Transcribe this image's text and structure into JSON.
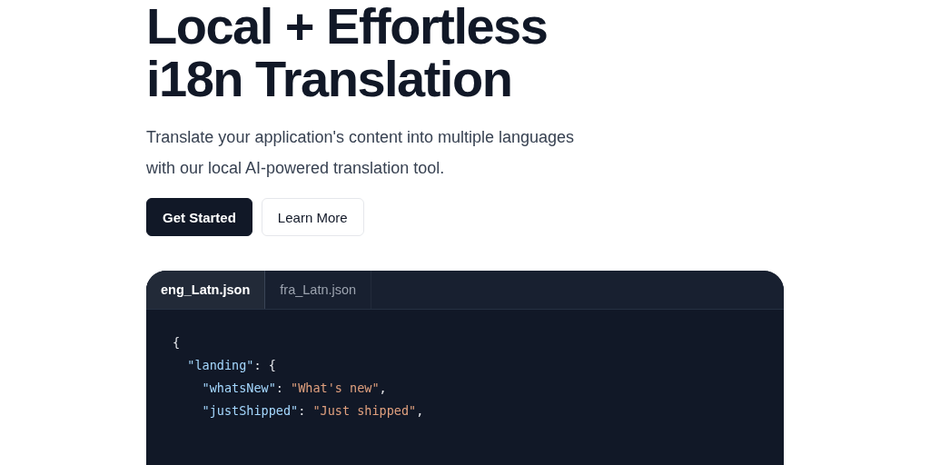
{
  "hero": {
    "title_lines": [
      "Local + Effortless",
      "i18n Translation"
    ],
    "description": "Translate your application's content into multiple languages with our local AI-powered translation tool.",
    "buttons": [
      {
        "label": "Get Started",
        "kind": "primary"
      },
      {
        "label": "Learn More",
        "kind": "secondary"
      }
    ]
  },
  "code_panel": {
    "tabs": [
      {
        "label": "eng_Latn.json",
        "selected": true
      },
      {
        "label": "fra_Latn.json",
        "selected": false
      }
    ],
    "lines": [
      {
        "tokens": [
          {
            "kind": "punct",
            "text": "{"
          }
        ]
      },
      {
        "tokens": [
          {
            "kind": "key",
            "text": "  \"landing\""
          },
          {
            "kind": "punct",
            "text": ": {"
          }
        ]
      },
      {
        "tokens": [
          {
            "kind": "key",
            "text": "    \"whatsNew\""
          },
          {
            "kind": "punct",
            "text": ": "
          },
          {
            "kind": "string",
            "text": "\"What's new\""
          },
          {
            "kind": "punct",
            "text": ","
          }
        ]
      },
      {
        "tokens": [
          {
            "kind": "key",
            "text": "    \"justShipped\""
          },
          {
            "kind": "punct",
            "text": ": "
          },
          {
            "kind": "string",
            "text": "\"Just shipped\""
          },
          {
            "kind": "punct",
            "text": ","
          }
        ]
      }
    ]
  }
}
